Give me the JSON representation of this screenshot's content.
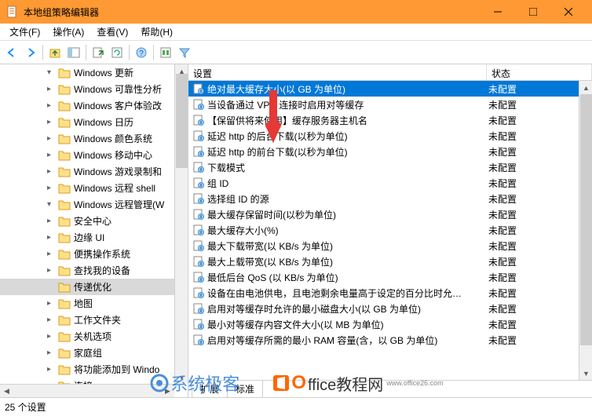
{
  "window": {
    "title": "本地组策略编辑器"
  },
  "menu": {
    "file": "文件(F)",
    "action": "操作(A)",
    "view": "查看(V)",
    "help": "帮助(H)"
  },
  "tree": {
    "items": [
      {
        "label": "Windows 更新",
        "expanded": true
      },
      {
        "label": "Windows 可靠性分析",
        "expanded": false
      },
      {
        "label": "Windows 客户体验改",
        "expanded": false
      },
      {
        "label": "Windows 日历",
        "expanded": false
      },
      {
        "label": "Windows 颜色系统",
        "expanded": false
      },
      {
        "label": "Windows 移动中心",
        "expanded": false
      },
      {
        "label": "Windows 游戏录制和",
        "expanded": false
      },
      {
        "label": "Windows 远程 shell",
        "expanded": false
      },
      {
        "label": "Windows 远程管理(W",
        "expanded": true
      },
      {
        "label": "安全中心",
        "expanded": false
      },
      {
        "label": "边缘 UI",
        "expanded": false
      },
      {
        "label": "便携操作系统",
        "expanded": false
      },
      {
        "label": "查找我的设备",
        "expanded": false
      },
      {
        "label": "传递优化",
        "selected": true
      },
      {
        "label": "地图",
        "expanded": false
      },
      {
        "label": "工作文件夹",
        "expanded": false
      },
      {
        "label": "关机选项",
        "expanded": false
      },
      {
        "label": "家庭组",
        "expanded": false
      },
      {
        "label": "将功能添加到 Windo",
        "expanded": false
      },
      {
        "label": "连接",
        "expanded": false
      }
    ]
  },
  "list": {
    "header_setting": "设置",
    "header_state": "状态",
    "rows": [
      {
        "name": "绝对最大缓存大小(以 GB 为单位)",
        "state": "未配置",
        "selected": true
      },
      {
        "name": "当设备通过 VPN 连接时启用对等缓存",
        "state": "未配置"
      },
      {
        "name": "【保留供将来使用】缓存服务器主机名",
        "state": "未配置"
      },
      {
        "name": "延迟 http 的后台下载(以秒为单位)",
        "state": "未配置"
      },
      {
        "name": "延迟 http 的前台下载(以秒为单位)",
        "state": "未配置"
      },
      {
        "name": "下载模式",
        "state": "未配置"
      },
      {
        "name": "组 ID",
        "state": "未配置"
      },
      {
        "name": "选择组 ID 的源",
        "state": "未配置"
      },
      {
        "name": "最大缓存保留时间(以秒为单位)",
        "state": "未配置"
      },
      {
        "name": "最大缓存大小(%)",
        "state": "未配置"
      },
      {
        "name": "最大下载带宽(以 KB/s 为单位)",
        "state": "未配置"
      },
      {
        "name": "最大上载带宽(以 KB/s 为单位)",
        "state": "未配置"
      },
      {
        "name": "最低后台 QoS (以 KB/s 为单位)",
        "state": "未配置"
      },
      {
        "name": "设备在由电池供电，且电池剩余电量高于设定的百分比时允…",
        "state": "未配置"
      },
      {
        "name": "启用对等缓存时允许的最小磁盘大小(以 GB 为单位)",
        "state": "未配置"
      },
      {
        "name": "最小对等缓存内容文件大小(以 MB 为单位)",
        "state": "未配置"
      },
      {
        "name": "启用对等缓存所需的最小 RAM 容量(含，以 GB 为单位)",
        "state": "未配置"
      }
    ]
  },
  "tabs": {
    "extended": "扩展",
    "standard": "标准"
  },
  "statusbar": {
    "text": "25 个设置"
  },
  "watermark": {
    "left": "系统极客",
    "right_brand": "ffice教程网",
    "right_url": "www.office26.com"
  }
}
